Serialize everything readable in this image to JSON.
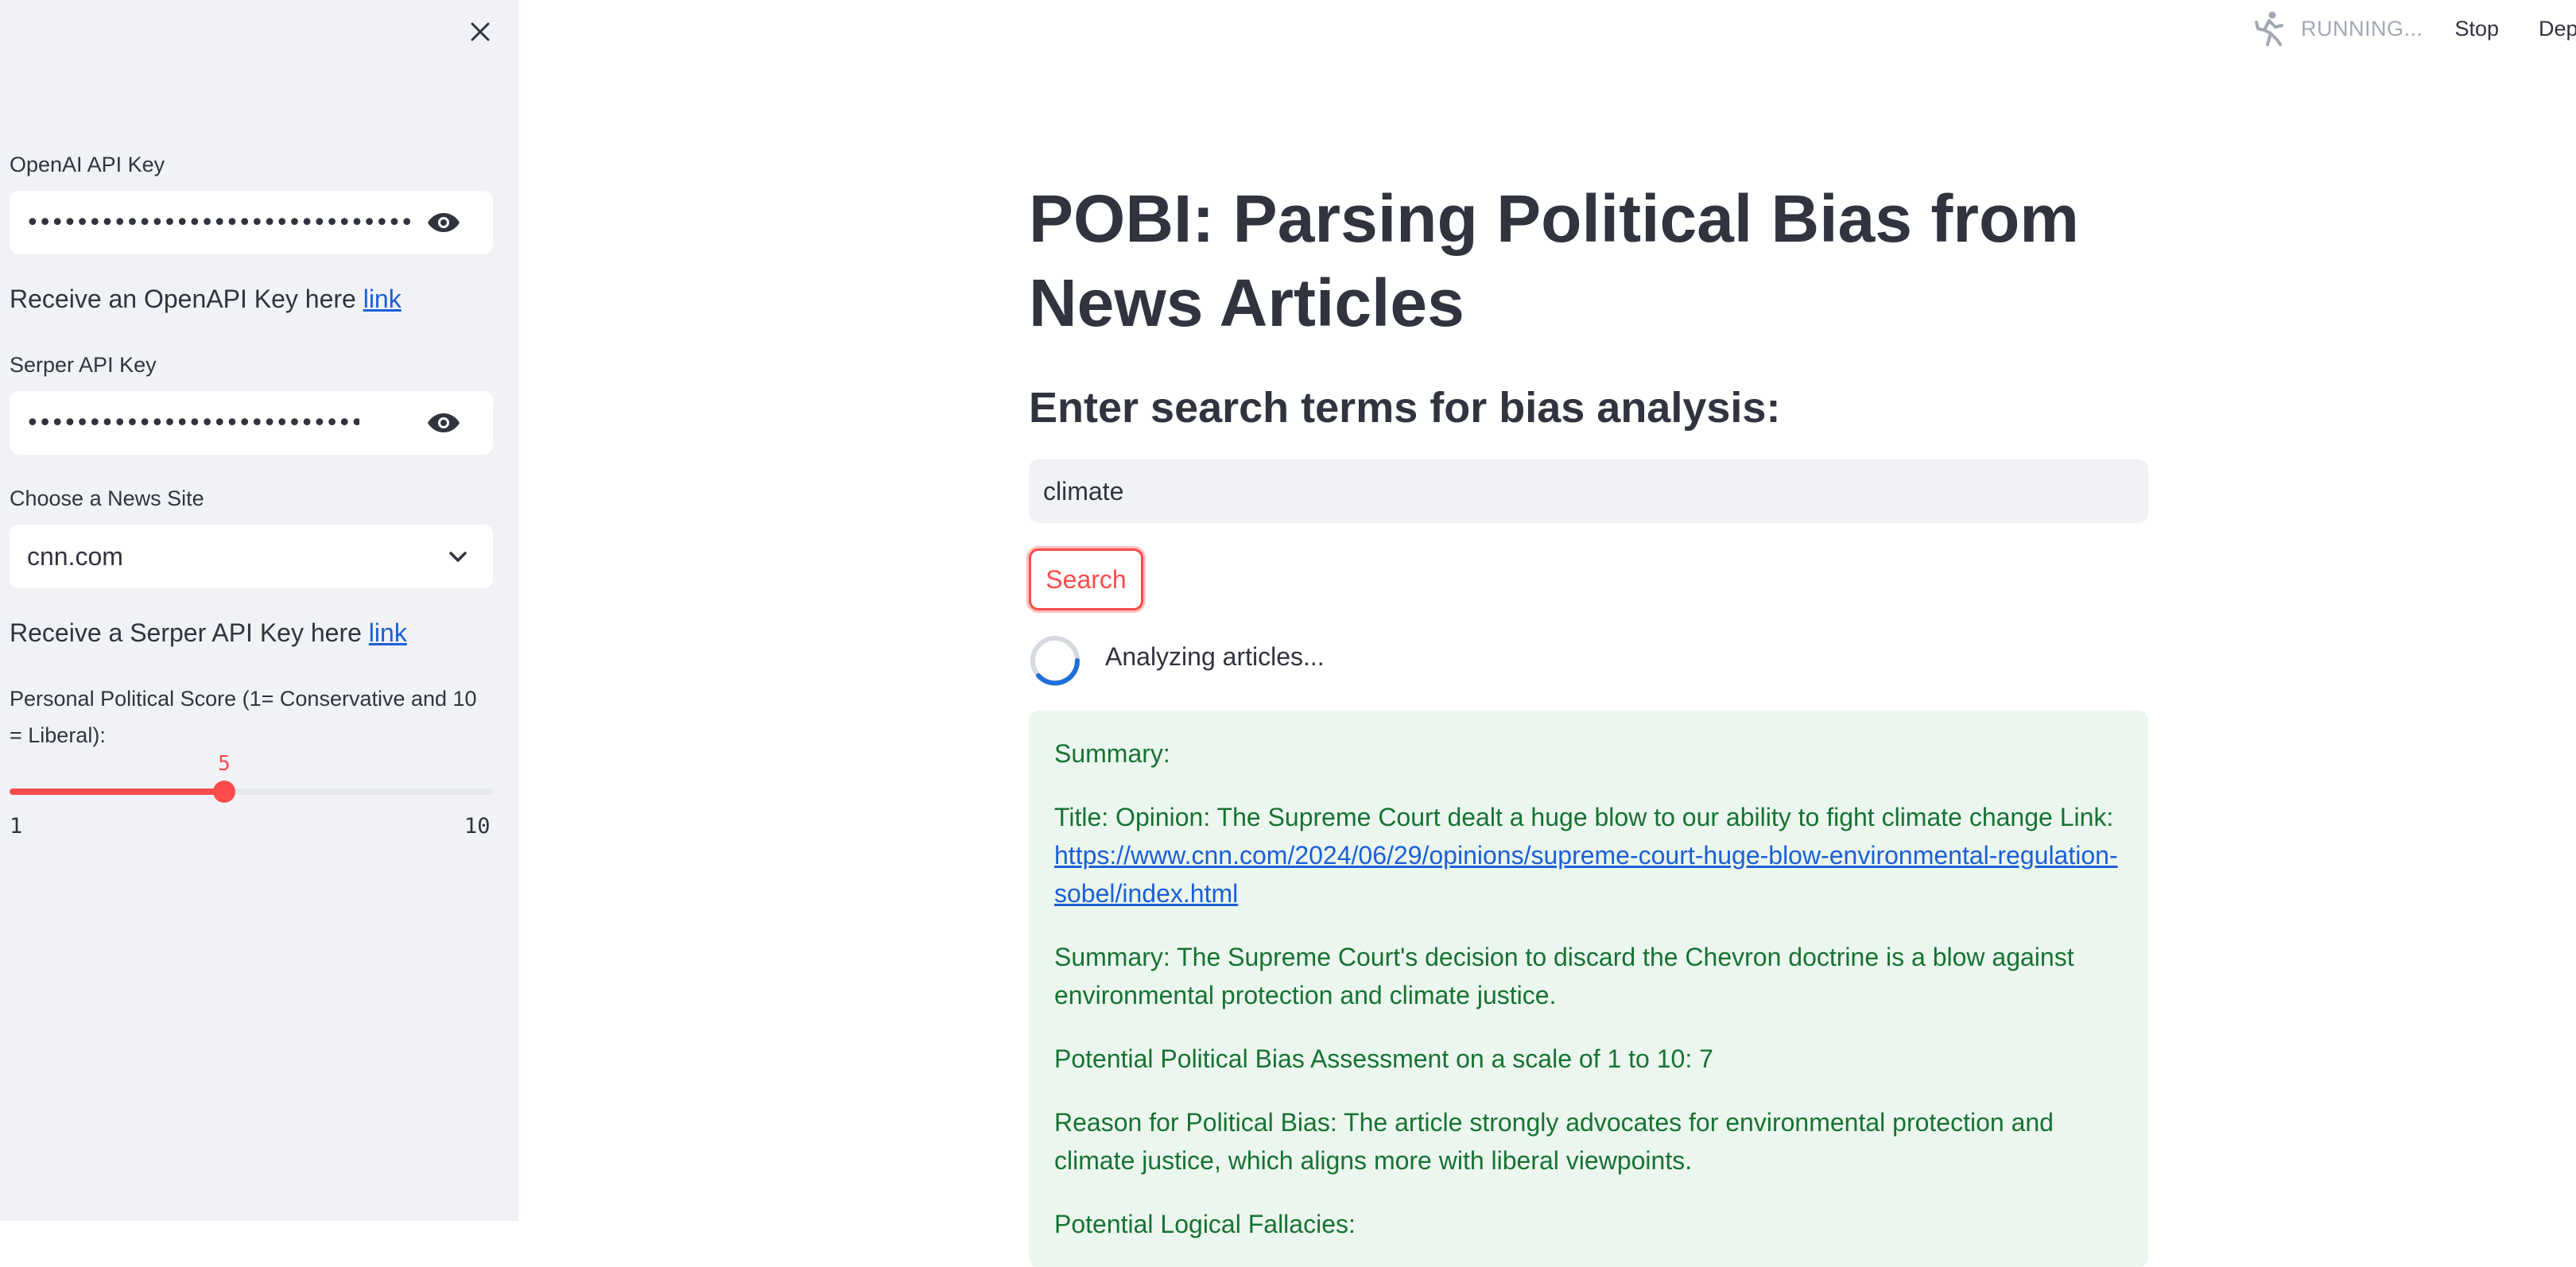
{
  "sidebar": {
    "openai_label": "OpenAI API Key",
    "openai_value": "••••••••••••••••••••••••••••••••••••••••••••••••••••••••",
    "openai_hint_text": "Receive an OpenAPI Key here ",
    "openai_hint_link": "link",
    "serper_label": "Serper API Key",
    "serper_value": "••••••••••••••••••••••••••••••••••••••••",
    "site_label": "Choose a News Site",
    "site_selected": "cnn.com",
    "serper_hint_text": "Receive a Serper API Key here ",
    "serper_hint_link": "link",
    "slider": {
      "label": "Personal Political Score (1= Conservative and 10 = Liberal):",
      "value": "5",
      "min": "1",
      "max": "10",
      "fraction": 0.444,
      "color": "#ff4b4b"
    }
  },
  "header": {
    "status": "RUNNING...",
    "stop_label": "Stop",
    "deploy_label": "Deploy"
  },
  "main": {
    "title": "POBI: Parsing Political Bias from News Articles",
    "subheader": "Enter search terms for bias analysis:",
    "search_value": "climate",
    "search_button": "Search",
    "spinner_text": "Analyzing articles...",
    "result": {
      "summary_heading": "Summary:",
      "title_line": "Title: Opinion: The Supreme Court dealt a huge blow to our ability to fight climate change Link: ",
      "link": "https://www.cnn.com/2024/06/29/opinions/supreme-court-huge-blow-environmental-regulation-sobel/index.html",
      "summary": "Summary: The Supreme Court's decision to discard the Chevron doctrine is a blow against environmental protection and climate justice.",
      "bias_assessment": "Potential Political Bias Assessment on a scale of 1 to 10: 7",
      "bias_reason": "Reason for Political Bias: The article strongly advocates for environmental protection and climate justice, which aligns more with liberal viewpoints.",
      "fallacies_heading": "Potential Logical Fallacies:"
    }
  },
  "colors": {
    "accent": "#ff4b4b",
    "sidebar_bg": "#f0f2f6",
    "success_bg": "#ebf7ee",
    "success_text": "#177233",
    "link": "#1c5fd6"
  }
}
